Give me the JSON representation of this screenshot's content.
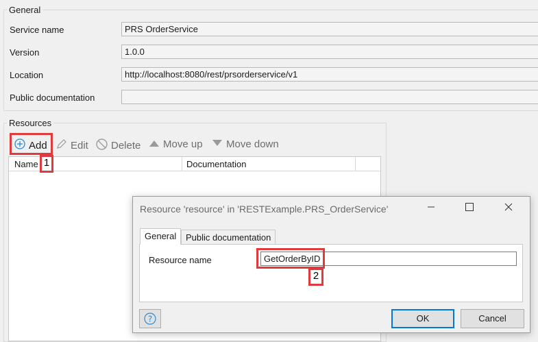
{
  "general": {
    "title": "General",
    "fields": [
      {
        "label": "Service name",
        "value": "PRS OrderService"
      },
      {
        "label": "Version",
        "value": "1.0.0"
      },
      {
        "label": "Location",
        "value": "http://localhost:8080/rest/prsorderservice/v1"
      },
      {
        "label": "Public documentation",
        "value": ""
      }
    ]
  },
  "resources": {
    "title": "Resources",
    "toolbar": {
      "add": "Add",
      "edit": "Edit",
      "delete": "Delete",
      "move_up": "Move up",
      "move_down": "Move down"
    },
    "columns": [
      "Name",
      "Documentation"
    ]
  },
  "callouts": {
    "first": "1",
    "second": "2"
  },
  "dialog": {
    "title": "Resource 'resource' in 'RESTExample.PRS_OrderService'",
    "tabs": [
      "General",
      "Public documentation"
    ],
    "resource_name_label": "Resource name",
    "resource_name_value": "GetOrderByID",
    "ok_label": "OK",
    "cancel_label": "Cancel"
  },
  "colors": {
    "callout": "#e0393e",
    "add_icon": "#2a8ad4",
    "primary_border": "#0078d7"
  }
}
